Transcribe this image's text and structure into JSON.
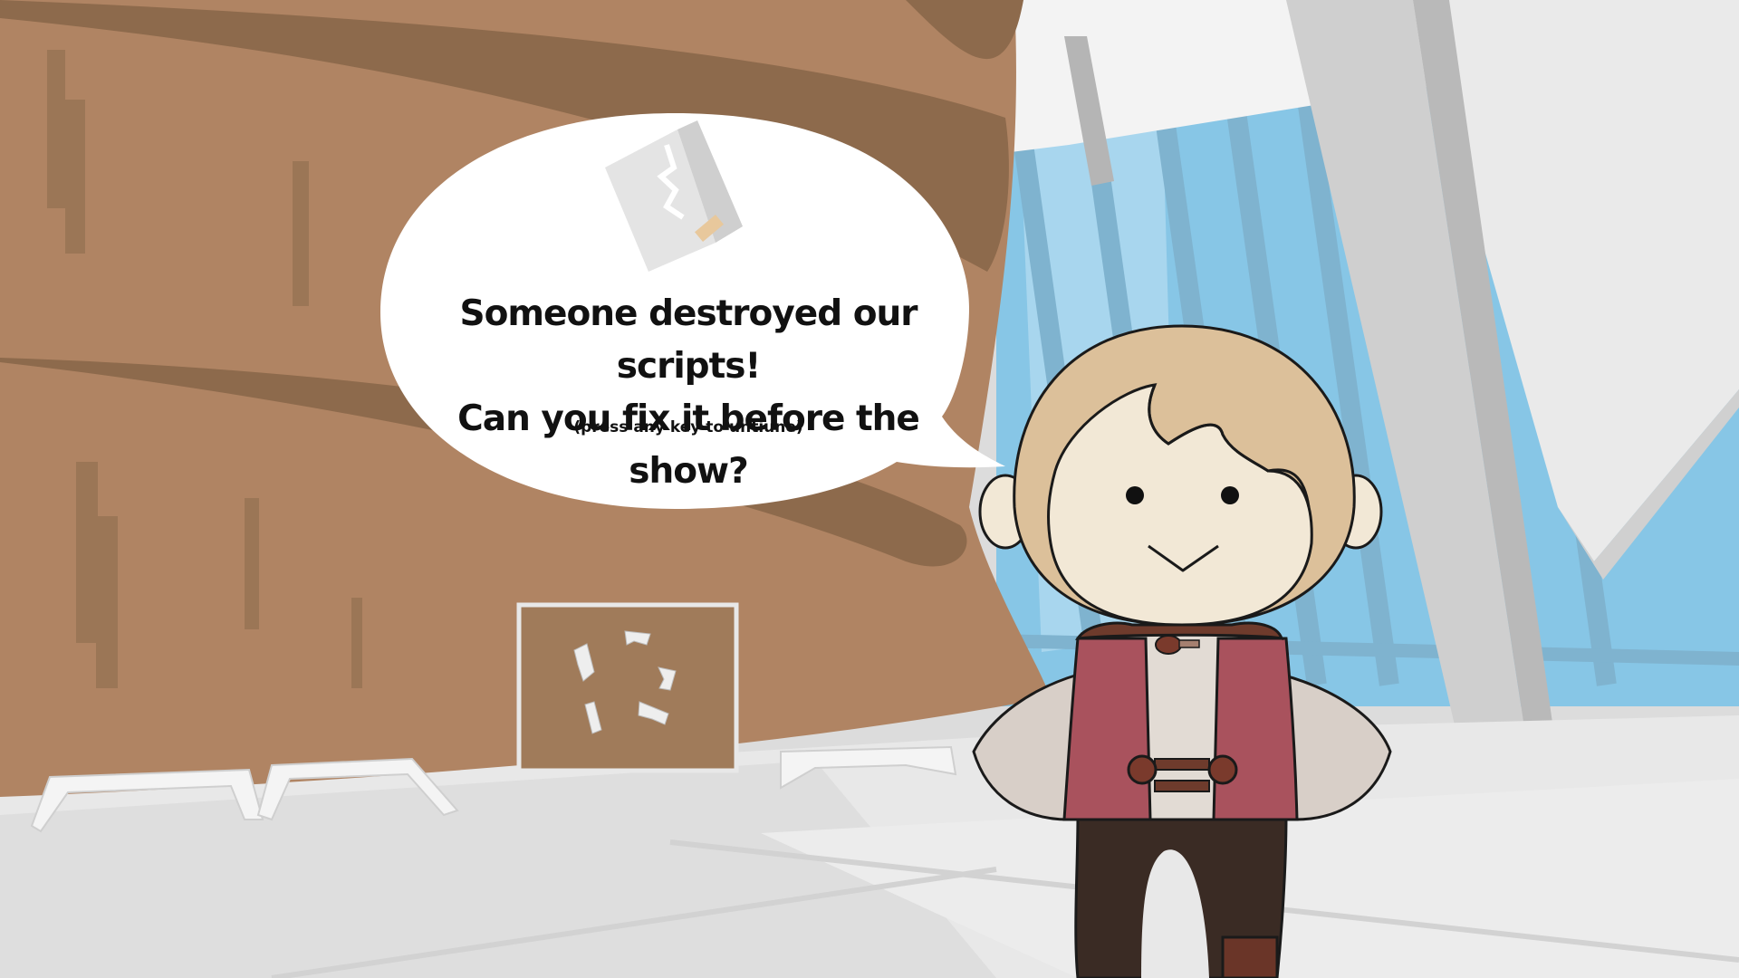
{
  "dialogue": {
    "line1": "Someone destroyed our scripts!",
    "line2": "Can you fix it before the show?",
    "hint": "(press any key to untiune)"
  },
  "icons": {
    "bubble_icon": "torn-script-icon",
    "character": "stage-kid-character"
  },
  "colors": {
    "wall": "#b08463",
    "wall_shadow": "#8d6a4c",
    "floor": "#e6e6e6",
    "sky": "#87c6e6",
    "beam": "#c8c8c8",
    "vest": "#a9525d",
    "hair": "#dcc09a",
    "skin": "#f2e8d6"
  }
}
